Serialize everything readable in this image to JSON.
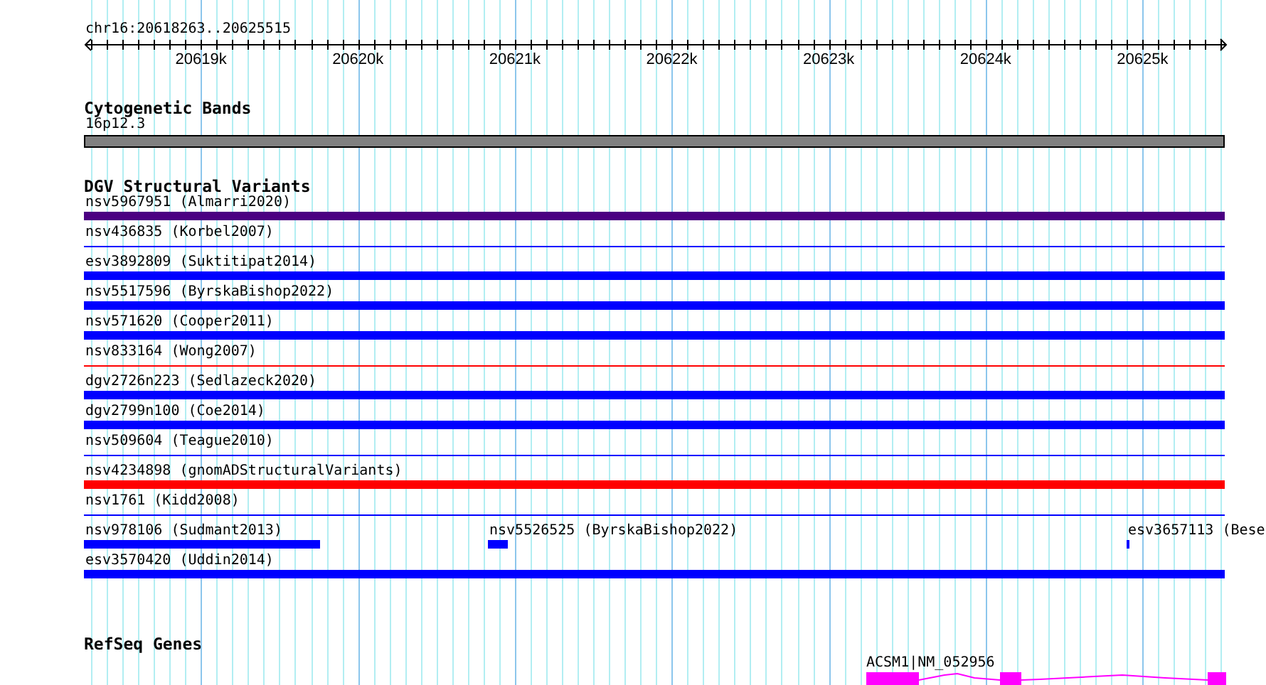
{
  "ruler": {
    "location": "chr16:20618263..20625515",
    "tick_labels": [
      "20619k",
      "20620k",
      "20621k",
      "20622k",
      "20623k",
      "20624k",
      "20625k"
    ]
  },
  "cytogenetic_bands": {
    "title": "Cytogenetic Bands",
    "band": {
      "label": "16p12.3",
      "color": "#808080"
    }
  },
  "dgv_structural_variants": {
    "title": "DGV Structural Variants",
    "rows": [
      [
        {
          "label": "nsv5967951 (Almarri2020)",
          "color": "#4b0082",
          "kind": "thick"
        }
      ],
      [
        {
          "label": "nsv436835 (Korbel2007)",
          "color": "#0000ff",
          "kind": "thin"
        }
      ],
      [
        {
          "label": "esv3892809 (Suktitipat2014)",
          "color": "#0000ff",
          "kind": "thick"
        }
      ],
      [
        {
          "label": "nsv5517596 (ByrskaBishop2022)",
          "color": "#0000ff",
          "kind": "thick"
        }
      ],
      [
        {
          "label": "nsv571620 (Cooper2011)",
          "color": "#0000ff",
          "kind": "thick"
        }
      ],
      [
        {
          "label": "nsv833164 (Wong2007)",
          "color": "#ff0000",
          "kind": "thin"
        }
      ],
      [
        {
          "label": "dgv2726n223 (Sedlazeck2020)",
          "color": "#0000ff",
          "kind": "thick"
        }
      ],
      [
        {
          "label": "dgv2799n100 (Coe2014)",
          "color": "#0000ff",
          "kind": "thick"
        }
      ],
      [
        {
          "label": "nsv509604 (Teague2010)",
          "color": "#0000ff",
          "kind": "thin"
        }
      ],
      [
        {
          "label": "nsv4234898 (gnomADStructuralVariants)",
          "color": "#ff0000",
          "kind": "thick"
        }
      ],
      [
        {
          "label": "nsv1761 (Kidd2008)",
          "color": "#0000ff",
          "kind": "thin"
        }
      ],
      [
        {
          "label": "nsv978106 (Sudmant2013)",
          "color": "#0000ff",
          "kind": "thick"
        },
        {
          "label": "nsv5526525 (ByrskaBishop2022)",
          "color": "#0000ff",
          "kind": "thick"
        },
        {
          "label": "esv3657113 (Bese",
          "color": "#0000ff",
          "kind": "thick"
        }
      ],
      [
        {
          "label": "esv3570420 (Uddin2014)",
          "color": "#0000ff",
          "kind": "thick"
        }
      ]
    ]
  },
  "refseq_genes": {
    "title": "RefSeq Genes",
    "genes": [
      {
        "label": "ACSM1|NM_052956",
        "color": "#ff00ff"
      }
    ]
  }
}
